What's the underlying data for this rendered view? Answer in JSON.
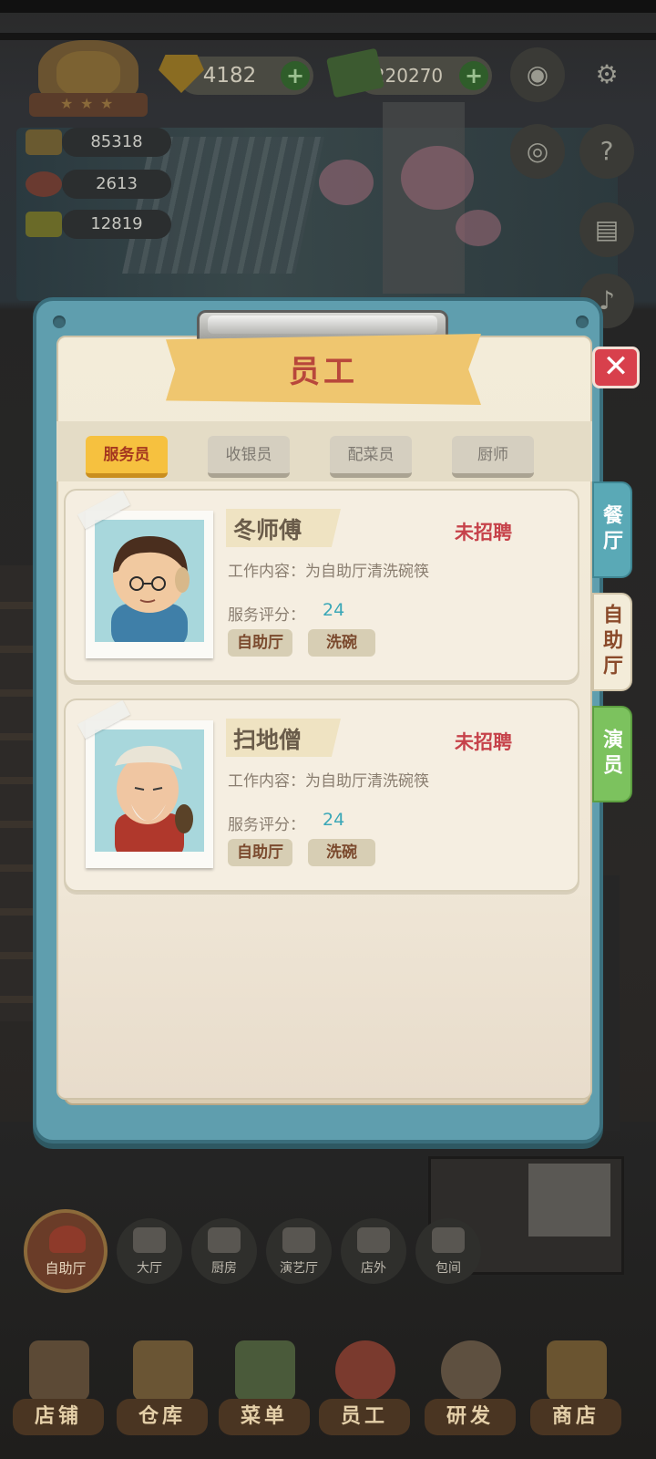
{
  "hud": {
    "gems": "4182",
    "cash": "220270",
    "stats": [
      "85318",
      "2613",
      "12819"
    ]
  },
  "dialog": {
    "title": "员工",
    "close_symbol": "✕",
    "top_tabs": [
      "服务员",
      "收银员",
      "配菜员",
      "厨师"
    ],
    "active_top_tab": "服务员",
    "side_tabs": [
      {
        "label": "餐厅",
        "color": "#5aa9b6"
      },
      {
        "label": "自助厅",
        "color": "#f3ecd9"
      },
      {
        "label": "演员",
        "color": "#7cc25e"
      }
    ],
    "active_side_tab": "自助厅",
    "desc_label": "工作内容：",
    "score_label": "服务评分：",
    "staff": [
      {
        "name": "冬师傅",
        "status": "未招聘",
        "desc": "为自助厅清洗碗筷",
        "score": "24",
        "tags": [
          "自助厅",
          "洗碗"
        ]
      },
      {
        "name": "扫地僧",
        "status": "未招聘",
        "desc": "为自助厅清洗碗筷",
        "score": "24",
        "tags": [
          "自助厅",
          "洗碗"
        ]
      }
    ]
  },
  "subnav": {
    "active": "自助厅",
    "items": [
      "大厅",
      "厨房",
      "演艺厅",
      "店外",
      "包间"
    ]
  },
  "bottom_nav": [
    "店铺",
    "仓库",
    "菜单",
    "员工",
    "研发",
    "商店"
  ],
  "colors": {
    "accent_red": "#c6424a",
    "score_teal": "#3aa7b7",
    "panel_blue": "#5f9eae",
    "active_tab_yellow": "#f6c13f"
  }
}
